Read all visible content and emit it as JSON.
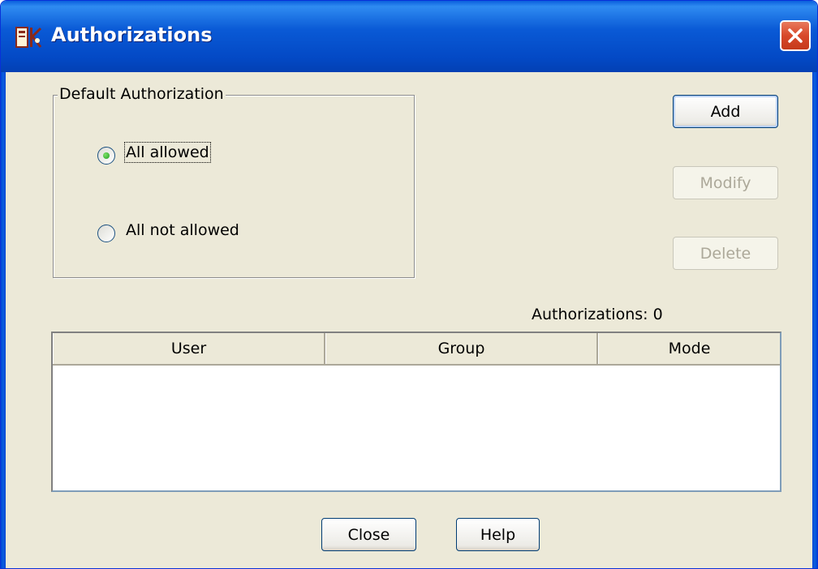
{
  "window": {
    "title": "Authorizations",
    "close_icon": "close-x-icon",
    "app_icon": "app-icon"
  },
  "default_authorization": {
    "legend": "Default Authorization",
    "options": [
      {
        "label": "All allowed",
        "selected": true
      },
      {
        "label": "All not allowed",
        "selected": false
      }
    ]
  },
  "actions": {
    "add": "Add",
    "modify": "Modify",
    "delete": "Delete"
  },
  "authorizations_count": "Authorizations: 0",
  "table": {
    "columns": [
      "User",
      "Group",
      "Mode"
    ],
    "rows": []
  },
  "footer": {
    "close": "Close",
    "help": "Help"
  },
  "colors": {
    "titlebar": "#0a5ad6",
    "dialog_bg": "#ece9d8",
    "close_button": "#d8482a",
    "radio_dot": "#21a121"
  }
}
